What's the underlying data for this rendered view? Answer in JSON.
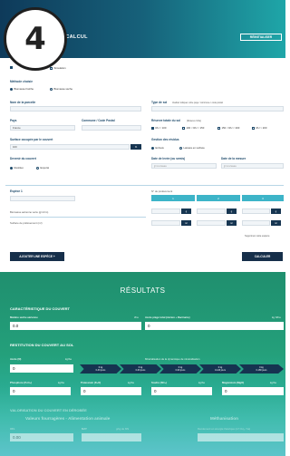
{
  "header": {
    "step": "4",
    "title": "UN CALCUL",
    "reset_label": "RÉINITIALISER"
  },
  "form": {
    "top_options": {
      "opt1": "",
      "opt2": "Simulation"
    },
    "method": {
      "label": "Méthode choisie",
      "opt_a": "Biomasse fraîche",
      "opt_b": "Biomasse sèche"
    },
    "parcel": {
      "label": "Nom de la parcelle",
      "value": ""
    },
    "soil": {
      "label": "Type de sol",
      "hint": "Veuillez indiquer votre pays / commune / code postal",
      "value": ""
    },
    "country": {
      "label": "Pays",
      "value": "France"
    },
    "commune": {
      "label": "Commune / Code Postal",
      "value": ""
    },
    "soil_reserve": {
      "label": "Réserve totale du sol",
      "unit": "(Réserve Utile)",
      "options": [
        "RU < 100",
        "100 < RU < 150",
        "150 < RU < 200",
        "RU > 200"
      ]
    },
    "surface": {
      "label": "Surface occupée par le couvert",
      "value": "100",
      "unit": "%"
    },
    "residue": {
      "label": "Gestion des résidus",
      "opt_a": "Enfouis",
      "opt_b": "Laissés en surface"
    },
    "cover_dev": {
      "label": "Devenir du couvert",
      "opt_a": "Restitué",
      "opt_b": "Exporté"
    },
    "sowing_date": {
      "label": "Date de levée (ou semis)",
      "placeholder": "jj/mm/aaaa"
    },
    "measure_date": {
      "label": "Date de la mesure",
      "placeholder": "jj/mm/aaaa"
    },
    "species": {
      "label": "Espèce 1",
      "value": "",
      "biomass_label": "Biomasse aérienne verte (g/m²/m)",
      "sampling_label": "Surface de prélèvement (m²)"
    },
    "sampling": {
      "label": "N° de prélèvement",
      "headers": [
        "1",
        "2",
        "3"
      ],
      "units": [
        "m²",
        "m²",
        "m²"
      ]
    },
    "delete_species": "Supprimer cette espèce",
    "add_species": "AJOUTER UNE ESPÈCE +",
    "calculate": "CALCULER"
  },
  "results": {
    "title": "RÉSULTATS",
    "cover_section": "CARACTÉRISTIQUE DU COUVERT",
    "dry_matter": {
      "label": "Matière sèche aérienne",
      "unit": "t/ha",
      "value": "0.0"
    },
    "n_total": {
      "label": "Azote piégé total (Aérien + Racinaire)",
      "unit": "kg N/ha",
      "value": "0"
    },
    "restitution_section": "RESTITUTION DU COUVERT AU SOL",
    "nitrogen": {
      "label": "Azote (N)",
      "unit": "kg/ha",
      "value": "0"
    },
    "mineral_label": "Minéralisation de la dynamique de minéralisation",
    "mineral_steps": [
      {
        "value": "0 kg",
        "period": "0-30 jours"
      },
      {
        "value": "0 kg",
        "period": "0-60 jours"
      },
      {
        "value": "0 kg",
        "period": "0-90 jours"
      },
      {
        "value": "0 kg",
        "period": "0-120 jours"
      },
      {
        "value": "0 kg",
        "period": "0-180 jours"
      }
    ],
    "nutrients": [
      {
        "label": "Phosphore (P₂O₅)",
        "unit": "kg/ha",
        "value": "0"
      },
      {
        "label": "Potassium (K₂O)",
        "unit": "kg/ha",
        "value": "0"
      },
      {
        "label": "Soufre (SO₃)",
        "unit": "kg/ha",
        "value": "0"
      },
      {
        "label": "Magnésium (MgO)",
        "unit": "kg/ha",
        "value": "0"
      }
    ],
    "valor_section": "VALORISATION DU COUVERT EN DÉROBÉE",
    "feed_title": "Valeurs fourragères - Alimentation animale",
    "methan_title": "Méthanisation",
    "ufl": {
      "label": "UFL",
      "value": "0.00"
    },
    "mat": {
      "label": "MAT",
      "unit": "g/kg de MS",
      "value": ""
    },
    "methane": {
      "label": "Rendement en énergie théorique (m³ CH₄ / ha)",
      "value": ""
    }
  }
}
